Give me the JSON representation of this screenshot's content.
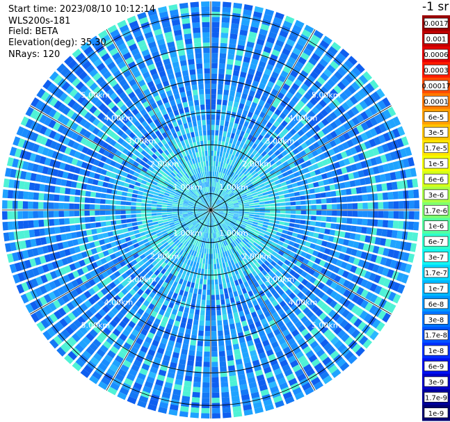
{
  "header": {
    "start_time": "Start time: 2023/08/10 10:12:14",
    "instrument": "WLS200s-181",
    "field": "Field: BETA",
    "elevation": "Elevation(deg): 35.30",
    "nrays": "NRays: 120"
  },
  "chart_data": {
    "type": "heatmap",
    "projection": "polar-ppi",
    "field": "BETA",
    "unit_label": "-1 sr",
    "nrays": 120,
    "elevation_deg": 35.3,
    "max_range_km": 6.4,
    "grid": true,
    "range_rings_km": [
      0.5,
      1.0,
      2.0,
      3.0,
      4.0,
      5.0,
      6.0
    ],
    "range_labels": [
      "1.00km",
      "2.00km",
      "3.00km",
      "4.00km",
      "5.00km"
    ],
    "colorbar": {
      "position": "right",
      "ticks": [
        "0.0017",
        "0.001",
        "0.0006",
        "0.0003",
        "0.00017",
        "0.0001",
        "6e-5",
        "3e-5",
        "1.7e-5",
        "1e-5",
        "6e-6",
        "3e-6",
        "1.7e-6",
        "1e-6",
        "6e-7",
        "3e-7",
        "1.7e-7",
        "1e-7",
        "6e-8",
        "3e-8",
        "1.7e-8",
        "1e-8",
        "6e-9",
        "3e-9",
        "1.7e-9",
        "1e-9"
      ],
      "colors": [
        "#9a0000",
        "#c00000",
        "#e40000",
        "#ff1a00",
        "#ff4d00",
        "#ff7a00",
        "#ffa000",
        "#ffc400",
        "#ffe400",
        "#f4ff00",
        "#d4ff1a",
        "#aaff44",
        "#80ff6e",
        "#55ffa0",
        "#2effcc",
        "#14f5f0",
        "#00d8ff",
        "#00b8ff",
        "#0096ff",
        "#0074ff",
        "#0052ff",
        "#0030ff",
        "#0010f0",
        "#0000c8",
        "#00009a",
        "#000070"
      ]
    },
    "palette": [
      "#0f5ff0",
      "#1478f5",
      "#1a8dff",
      "#1fa3ff",
      "#2bb8ff",
      "#35ccf5",
      "#3fe0e6",
      "#4ff2d6",
      "#2a62e8",
      "#1050e0"
    ]
  }
}
